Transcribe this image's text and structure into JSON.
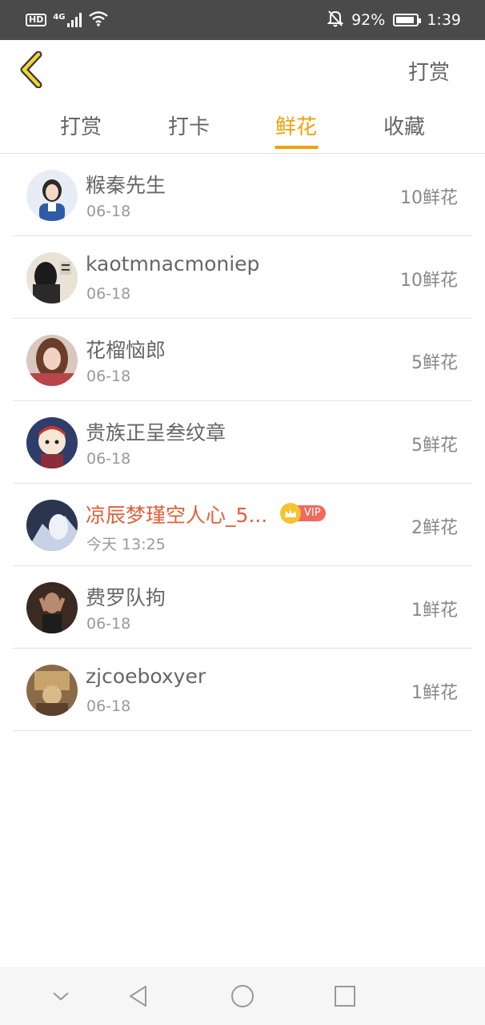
{
  "status_bar": {
    "hd": "HD",
    "network": "4G",
    "battery_percent": "92%",
    "time": "1:39"
  },
  "header": {
    "back_icon": "chevron-left-icon",
    "action_label": "打赏"
  },
  "tabs": [
    {
      "label": "打赏",
      "active": false
    },
    {
      "label": "打卡",
      "active": false
    },
    {
      "label": "鲜花",
      "active": true
    },
    {
      "label": "收藏",
      "active": false
    }
  ],
  "list": [
    {
      "name": "糇秦先生",
      "date": "06-18",
      "amount": "10鲜花"
    },
    {
      "name": "kaotmnacmoniep",
      "date": "06-18",
      "amount": "10鲜花"
    },
    {
      "name": "花榴恼郎",
      "date": "06-18",
      "amount": "5鲜花"
    },
    {
      "name": "贵族正呈叁纹章",
      "date": "06-18",
      "amount": "5鲜花"
    },
    {
      "name": "凉辰梦瑾空人心_5...",
      "date": "今天 13:25",
      "amount": "2鲜花",
      "vip": "VIP"
    },
    {
      "name": "费罗队拘",
      "date": "06-18",
      "amount": "1鲜花"
    },
    {
      "name": "zjcoeboxyer",
      "date": "06-18",
      "amount": "1鲜花"
    }
  ],
  "colors": {
    "accent": "#f0a20c",
    "vip_name": "#e0603a",
    "vip_badge": "#ef6b5d"
  },
  "nav_bar": {
    "icons": [
      "chevron-down-icon",
      "back-triangle-icon",
      "home-circle-icon",
      "recents-square-icon"
    ]
  }
}
